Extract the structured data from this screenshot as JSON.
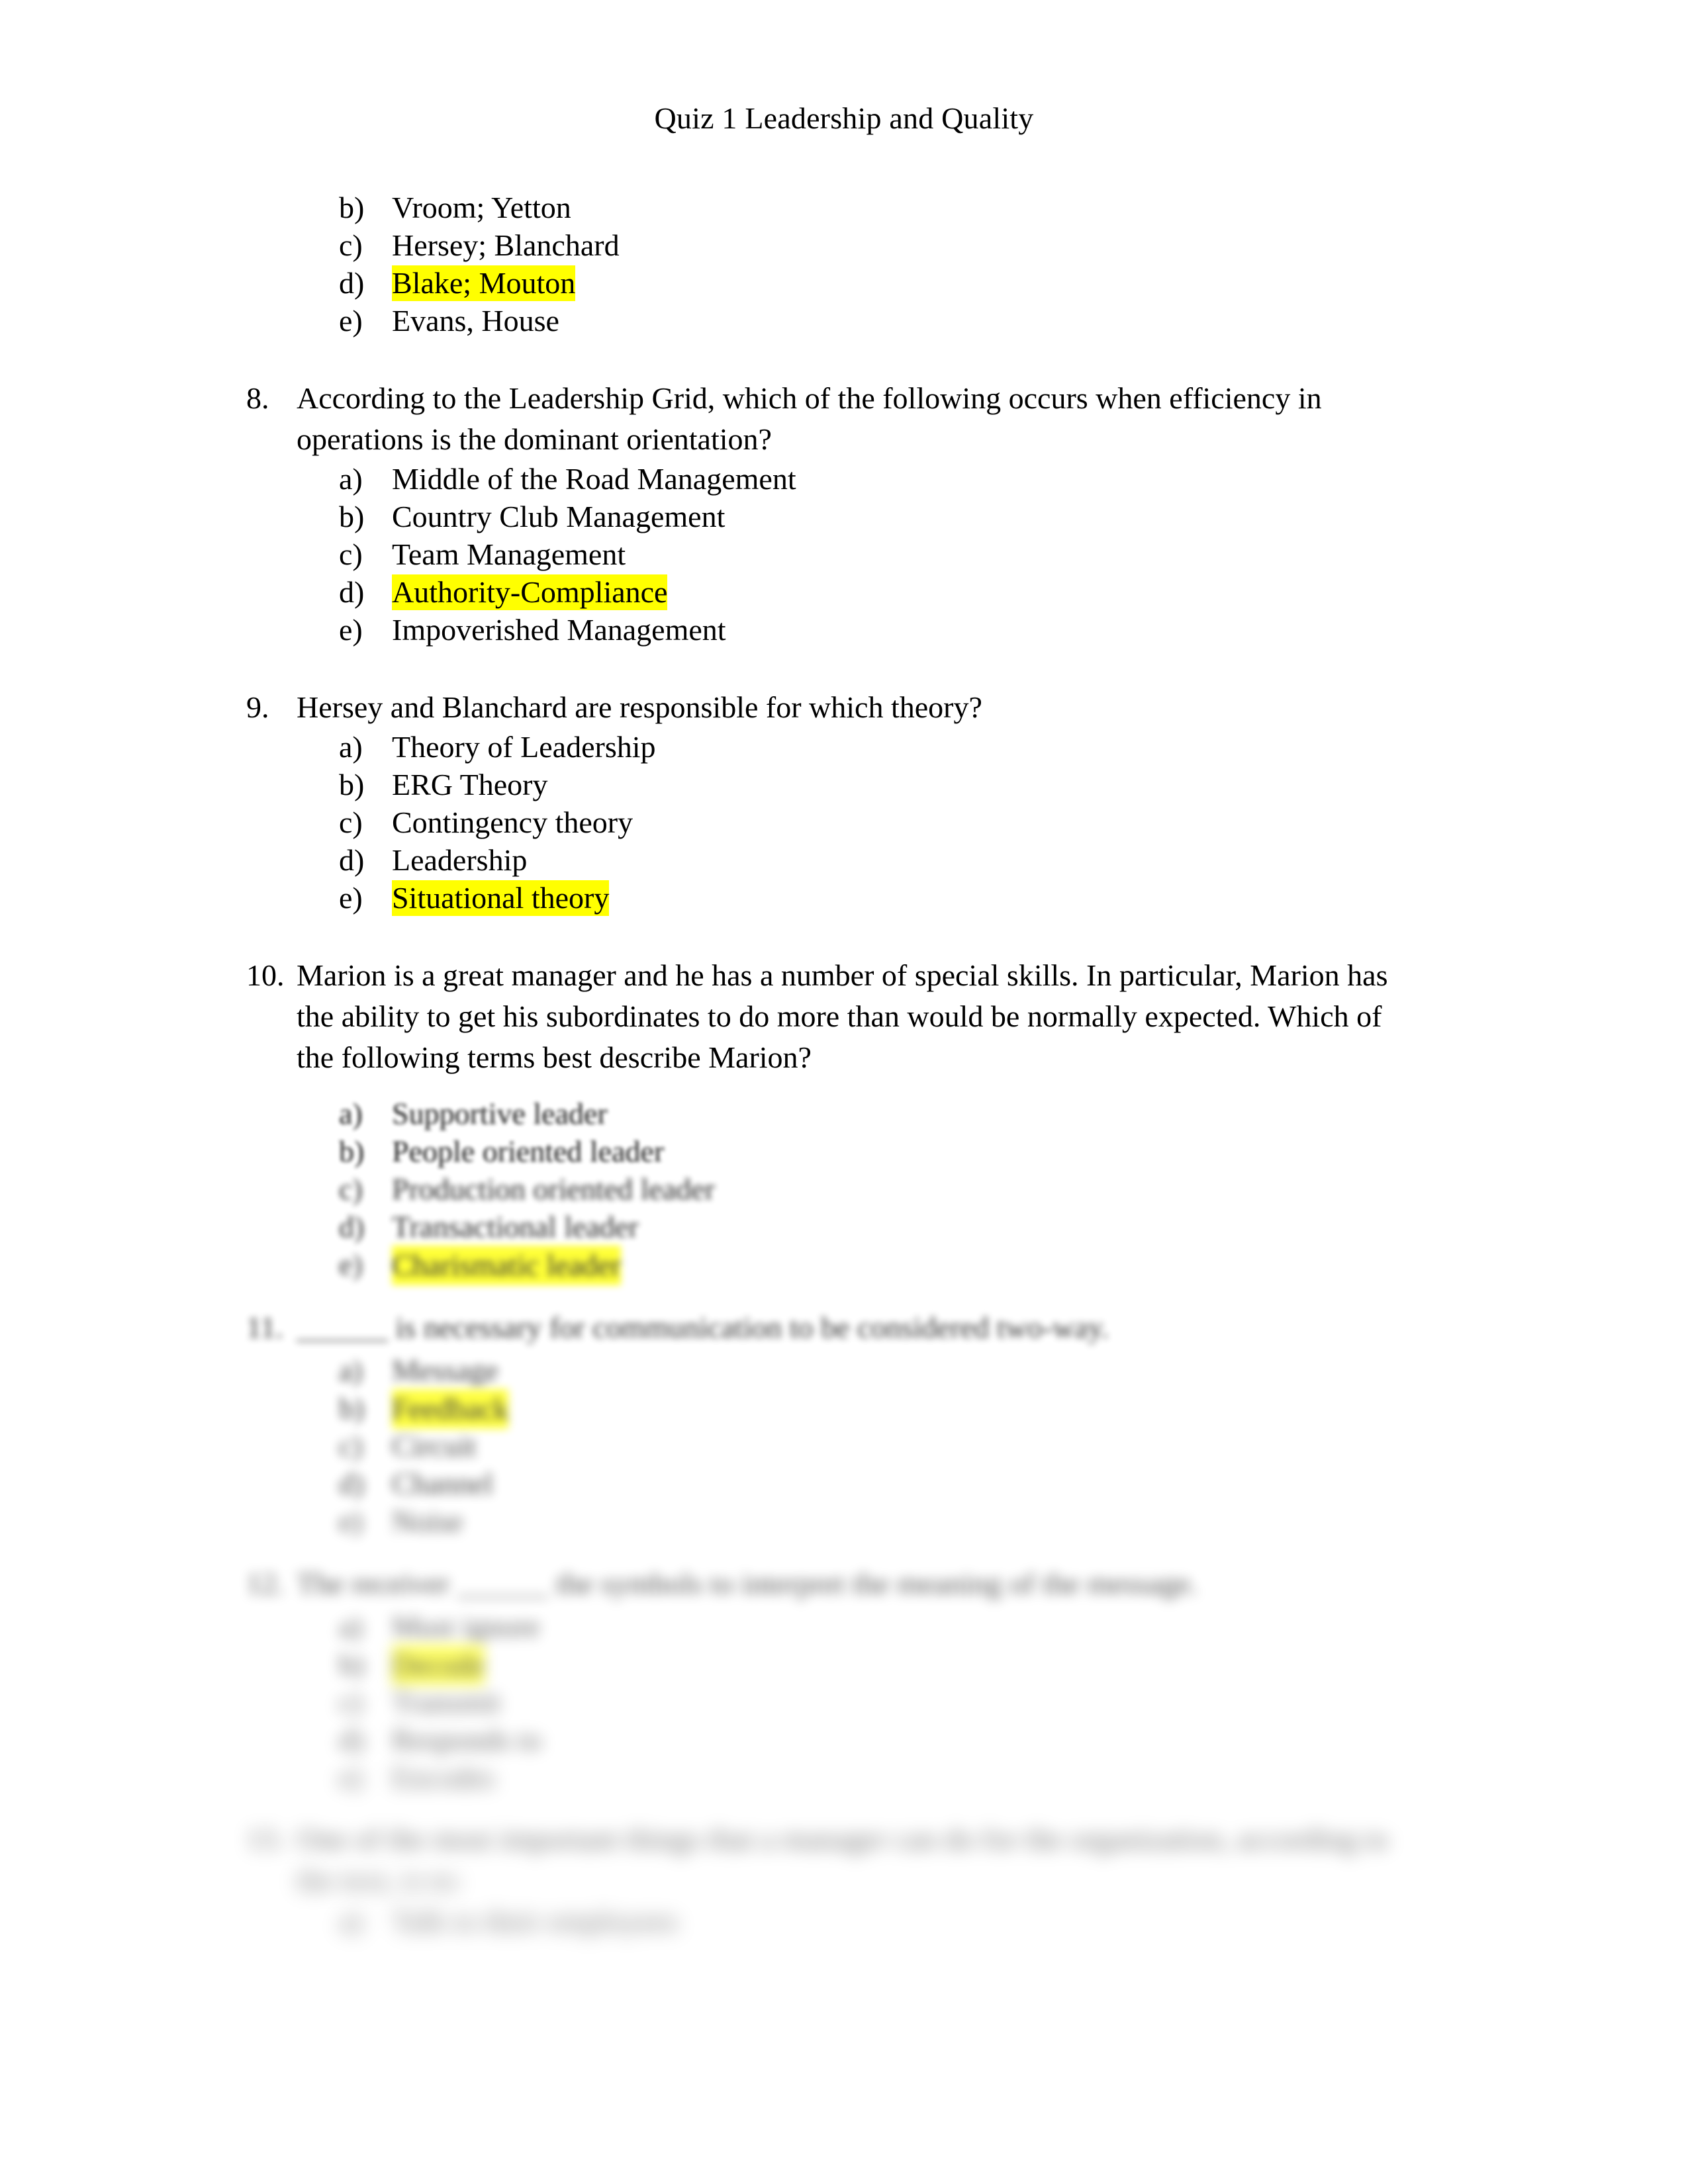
{
  "document": {
    "title": "Quiz 1 Leadership and Quality",
    "highlight_color": "#ffff00",
    "page_background": "#ffffff",
    "text_color": "#000000"
  },
  "carryover_options": {
    "note": "continuation of question 7 from the previous page",
    "items": [
      {
        "letter": "b)",
        "text": "Vroom; Yetton",
        "highlighted": false
      },
      {
        "letter": "c)",
        "text": "Hersey; Blanchard",
        "highlighted": false
      },
      {
        "letter": "d)",
        "text": "Blake; Mouton",
        "highlighted": true
      },
      {
        "letter": "e)",
        "text": "Evans, House",
        "highlighted": false
      }
    ]
  },
  "questions": [
    {
      "number": "8.",
      "stem_line1": "According to the Leadership Grid, which of the following occurs when efficiency in",
      "stem_line2": "operations is the dominant orientation?",
      "options": [
        {
          "letter": "a)",
          "text": "Middle of the Road Management",
          "highlighted": false
        },
        {
          "letter": "b)",
          "text": "Country Club Management",
          "highlighted": false
        },
        {
          "letter": "c)",
          "text": "Team Management",
          "highlighted": false
        },
        {
          "letter": "d)",
          "text": "Authority-Compliance",
          "highlighted": true
        },
        {
          "letter": "e)",
          "text": "Impoverished Management",
          "highlighted": false
        }
      ]
    },
    {
      "number": "9.",
      "stem_line1": "Hersey and Blanchard are responsible for which theory?",
      "stem_line2": "",
      "options": [
        {
          "letter": "a)",
          "text": "Theory of Leadership",
          "highlighted": false
        },
        {
          "letter": "b)",
          "text": "ERG Theory",
          "highlighted": false
        },
        {
          "letter": "c)",
          "text": "Contingency theory",
          "highlighted": false
        },
        {
          "letter": "d)",
          "text": "Leadership",
          "highlighted": false
        },
        {
          "letter": "e)",
          "text": "Situational theory",
          "highlighted": true
        }
      ]
    },
    {
      "number": "10.",
      "stem_line1": "Marion is a great manager and he has a number of special skills. In particular, Marion has",
      "stem_line2": "the ability to get his subordinates to do more than would be normally expected. Which of",
      "stem_line3": "the following terms best describe Marion?",
      "options": [
        {
          "letter": "a)",
          "text": "Supportive leader",
          "highlighted": false
        },
        {
          "letter": "b)",
          "text": "People oriented leader",
          "highlighted": false
        },
        {
          "letter": "c)",
          "text": "Production oriented leader",
          "highlighted": false
        },
        {
          "letter": "d)",
          "text": "Transactional leader",
          "highlighted": false
        },
        {
          "letter": "e)",
          "text": "Charismatic leader",
          "highlighted": true
        }
      ]
    },
    {
      "number": "11.",
      "stem_line1": "______ is necessary for communication to be considered two-way.",
      "options": [
        {
          "letter": "a)",
          "text": "Message",
          "highlighted": false
        },
        {
          "letter": "b)",
          "text": "Feedback",
          "highlighted": true
        },
        {
          "letter": "c)",
          "text": "Circuit",
          "highlighted": false
        },
        {
          "letter": "d)",
          "text": "Channel",
          "highlighted": false
        },
        {
          "letter": "e)",
          "text": "Noise",
          "highlighted": false
        }
      ]
    },
    {
      "number": "12.",
      "stem_line1": "The receiver ______ the symbols to interpret the meaning of the message.",
      "options": [
        {
          "letter": "a)",
          "text": "Must ignore",
          "highlighted": false
        },
        {
          "letter": "b)",
          "text": "Decode",
          "highlighted": true
        },
        {
          "letter": "c)",
          "text": "Transmit",
          "highlighted": false
        },
        {
          "letter": "d)",
          "text": "Responds to",
          "highlighted": false
        },
        {
          "letter": "e)",
          "text": "Encodes",
          "highlighted": false
        }
      ]
    },
    {
      "number": "13.",
      "stem_line1": "One of the most important things that a manager can do for the organization, according to",
      "stem_line2": "the text, is to:",
      "options": [
        {
          "letter": "a)",
          "text": "Talk to their employees",
          "highlighted": false
        }
      ]
    }
  ]
}
